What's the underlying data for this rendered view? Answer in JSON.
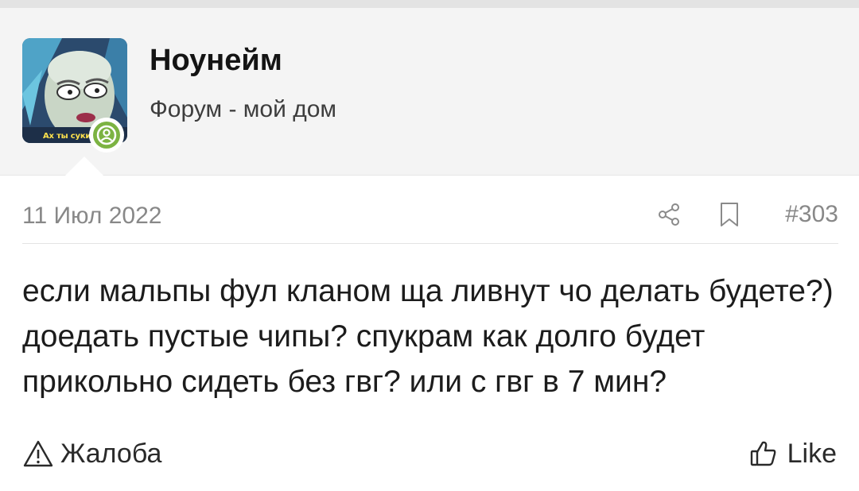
{
  "header": {
    "username": "Ноунейм",
    "user_title": "Форум - мой дом",
    "avatar_caption": "Ах ты сукин",
    "online_color": "#7cb342"
  },
  "post": {
    "date": "11 Июл 2022",
    "number": "#303",
    "message": "если мальпы фул кланом ща ливнут чо делать будете?) доедать пустые чипы? спукрам как долго будет прикольно сидеть без гвг? или с гвг в 7 мин?"
  },
  "actions": {
    "report_label": "Жалоба",
    "like_label": "Like"
  },
  "icons": {
    "share": "share-icon",
    "bookmark": "bookmark-icon",
    "report": "warning-triangle-icon",
    "like": "thumbs-up-icon",
    "online": "user-online-icon"
  }
}
